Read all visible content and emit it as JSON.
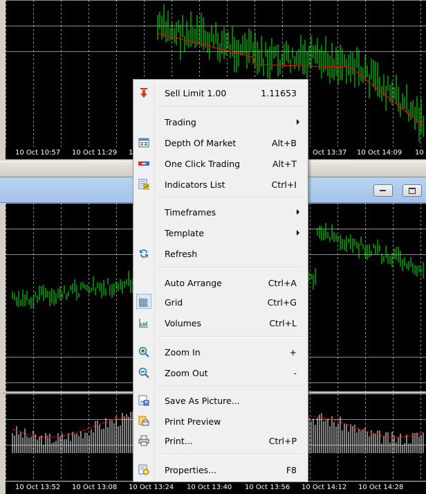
{
  "colors": {
    "chart_bg": "#000000",
    "bar_green": "#00ff00",
    "ma_red": "#ff0000",
    "volume_white": "#ffffff",
    "menu_bg": "#f0f0f0"
  },
  "top_chart": {
    "time_axis": [
      "10 Oct 10:57",
      "10 Oct 11:29",
      "1",
      "Oct 13:37",
      "10 Oct 14:09",
      "10"
    ]
  },
  "bottom_chart": {
    "time_axis": [
      "10 Oct 13:52",
      "10 Oct 13:08",
      "10 Oct 13:24",
      "10 Oct 13:40",
      "10 Oct 13:56",
      "10 Oct 14:12",
      "10 Oct 14:28"
    ]
  },
  "window_buttons": {
    "minimize_icon": "minimize-icon",
    "restore_icon": "restore-icon"
  },
  "menu": {
    "sell_limit": {
      "label": "Sell Limit 1.00",
      "price": "1.11653",
      "icon": "sell-arrow-icon"
    },
    "trading": {
      "label": "Trading"
    },
    "depth_of_market": {
      "label": "Depth Of Market",
      "shortcut": "Alt+B",
      "icon": "depth-of-market-icon"
    },
    "one_click_trading": {
      "label": "One Click Trading",
      "shortcut": "Alt+T",
      "icon": "one-click-trading-icon"
    },
    "indicators_list": {
      "label": "Indicators List",
      "shortcut": "Ctrl+I",
      "icon": "indicators-list-icon"
    },
    "timeframes": {
      "label": "Timeframes"
    },
    "template": {
      "label": "Template"
    },
    "refresh": {
      "label": "Refresh",
      "icon": "refresh-icon"
    },
    "auto_arrange": {
      "label": "Auto Arrange",
      "shortcut": "Ctrl+A"
    },
    "grid": {
      "label": "Grid",
      "shortcut": "Ctrl+G",
      "icon": "grid-icon",
      "checked": true
    },
    "volumes": {
      "label": "Volumes",
      "shortcut": "Ctrl+L",
      "icon": "volumes-icon"
    },
    "zoom_in": {
      "label": "Zoom In",
      "shortcut": "+",
      "icon": "zoom-in-icon"
    },
    "zoom_out": {
      "label": "Zoom Out",
      "shortcut": "-",
      "icon": "zoom-out-icon"
    },
    "save_as_picture": {
      "label": "Save As Picture...",
      "icon": "save-picture-icon"
    },
    "print_preview": {
      "label": "Print Preview",
      "icon": "print-preview-icon"
    },
    "print": {
      "label": "Print...",
      "shortcut": "Ctrl+P",
      "icon": "printer-icon"
    },
    "properties": {
      "label": "Properties...",
      "shortcut": "F8",
      "icon": "properties-icon"
    }
  }
}
